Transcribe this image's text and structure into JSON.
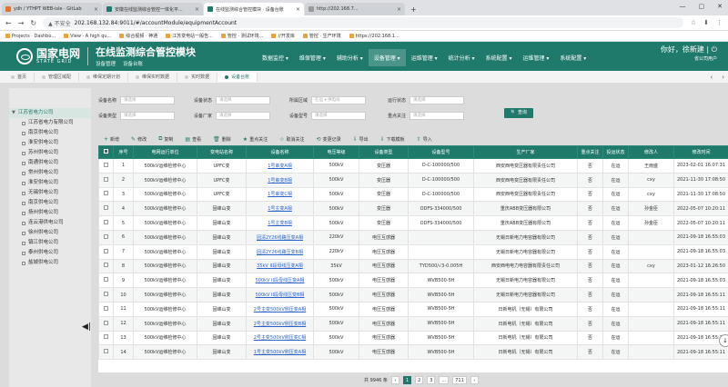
{
  "browser": {
    "tabs": [
      {
        "title": "ydh / YTHPT  WEB-isle · GitLab",
        "color": "#e2732b"
      },
      {
        "title": "安徽在线监测综合管控一体化平...",
        "color": "#1f7a6c"
      },
      {
        "title": "在线监测综合管控模块 · 设备台账",
        "color": "#1f7a6c"
      },
      {
        "title": "http://202.168.7...",
        "color": "#999999"
      }
    ],
    "new_tab": "+",
    "window_controls": [
      "—",
      "▢",
      "✕"
    ],
    "nav": [
      "←",
      "→",
      "↻"
    ],
    "url_warning": "▲ 不安全",
    "url": "202.168.132.84:9011/#/accountModule/equipmentAccount",
    "right_icons": [
      "☆",
      "⬇",
      "⋮"
    ],
    "bookmarks": [
      "Projects · Dashbo...",
      "View · A high qu...",
      "综合视频 · 神通",
      "江苏变电站一般告...",
      "管控 · 测试环境...",
      "//开发库",
      "管控 · 生产环境",
      "https://202.168.1..."
    ]
  },
  "header": {
    "logo_cn": "国家电网",
    "logo_en": "STATE GRID",
    "title": "在线监测综合管控模块",
    "sub": [
      "设备管理",
      "设备台账"
    ],
    "nav": [
      {
        "label": "数据监控 ▾",
        "active": false
      },
      {
        "label": "维保管理 ▾",
        "active": false
      },
      {
        "label": "辅助分析 ▾",
        "active": false
      },
      {
        "label": "设备管理 ▾",
        "active": true
      },
      {
        "label": "运维管理 ▾",
        "active": false
      },
      {
        "label": "统计分析 ▾",
        "active": false
      },
      {
        "label": "系统配置 ▾",
        "active": false
      },
      {
        "label": "运维管理 ▾",
        "active": false
      },
      {
        "label": "系统配置 ▾",
        "active": false
      }
    ],
    "greeting": "你好，徐新建 | ⏻",
    "role": "省公司用户"
  },
  "page_tabs": [
    {
      "label": "首页",
      "active": false
    },
    {
      "label": "管理区域配",
      "active": false
    },
    {
      "label": "维保定期计划",
      "active": false
    },
    {
      "label": "维保实时数据",
      "active": false
    },
    {
      "label": "实时数据",
      "active": false
    },
    {
      "label": "设备台账",
      "active": true
    }
  ],
  "page_tab_arrows": [
    "‹",
    "›"
  ],
  "sidebar": {
    "root": "江苏省电力公司",
    "items": [
      "江苏省电力有限公司",
      "南京供电公司",
      "淮安供电公司",
      "苏州供电公司",
      "南通供电公司",
      "常州供电公司",
      "淮安供电公司",
      "无锡供电公司",
      "南京供电公司",
      "扬州供电公司",
      "连云港供电公司",
      "徐州供电公司",
      "镇江供电公司",
      "泰州供电公司",
      "盐城供电公司"
    ],
    "collapse": "◀|"
  },
  "filters": [
    {
      "label": "设备名称",
      "placeholder": "请选择",
      "row": 0,
      "col": 0
    },
    {
      "label": "设备状态",
      "placeholder": "请选择",
      "row": 0,
      "col": 1
    },
    {
      "label": "所属区域",
      "placeholder": "在运 ▾  供电局",
      "row": 0,
      "col": 2
    },
    {
      "label": "运行状态",
      "placeholder": "请选择",
      "row": 0,
      "col": 3
    },
    {
      "label": "设备类型",
      "placeholder": "请选择",
      "row": 1,
      "col": 0
    },
    {
      "label": "设备厂家",
      "placeholder": "请选择",
      "row": 1,
      "col": 1
    },
    {
      "label": "设备型号",
      "placeholder": "请选择",
      "row": 1,
      "col": 2
    },
    {
      "label": "重点关注",
      "placeholder": "请选择",
      "row": 1,
      "col": 3
    }
  ],
  "query_button": "🔍 查询",
  "toolbar": [
    {
      "icon": "+",
      "label": "新增"
    },
    {
      "icon": "✎",
      "label": "修改"
    },
    {
      "icon": "⧉",
      "label": "复制"
    },
    {
      "icon": "▤",
      "label": "查看"
    },
    {
      "icon": "🗑",
      "label": "删除"
    },
    {
      "icon": "★",
      "label": "重点关注"
    },
    {
      "icon": "☆",
      "label": "取消关注"
    },
    {
      "icon": "⟲",
      "label": "变更记录"
    },
    {
      "icon": "⇩",
      "label": "导出"
    },
    {
      "icon": "⇩",
      "label": "下载模板"
    },
    {
      "icon": "⇧",
      "label": "导入"
    }
  ],
  "table": {
    "columns": [
      "",
      "序号",
      "电网运行单位",
      "变电站名称",
      "设备名称",
      "电压等级",
      "设备类型",
      "设备型号",
      "生产厂家",
      "重点关注",
      "投运状态",
      "修改人",
      "修改时间"
    ],
    "rows": [
      [
        "1",
        "500kV运维检修中心",
        "UPFC变",
        "1号串变A相",
        "500kV",
        "变压器",
        "D-C-100000/500",
        "西安西电变压器有限责任公司",
        "否",
        "在运",
        "王雨盛",
        "2023-02-01 16:07:31"
      ],
      [
        "2",
        "500kV运维检修中心",
        "UPFC变",
        "1号串变B相",
        "500kV",
        "变压器",
        "D-C-100000/500",
        "西安西电变压器有限责任公司",
        "否",
        "在运",
        "cxy",
        "2021-11-30 17:08:50"
      ],
      [
        "3",
        "500kV运维检修中心",
        "UPFC变",
        "1号串变C相",
        "500kV",
        "变压器",
        "D-C-100000/500",
        "西安西电变压器有限责任公司",
        "否",
        "在运",
        "cxy",
        "2021-11-30 17:08:50"
      ],
      [
        "4",
        "500kV运维检修中心",
        "固峰山变",
        "1号主变A相",
        "500kV",
        "变压器",
        "ODFS-334000/500",
        "重庆ABB变压器有限公司",
        "否",
        "在运",
        "孙金臣",
        "2022-05-07 10:20:11"
      ],
      [
        "5",
        "500kV运维检修中心",
        "固峰山变",
        "1号主变B相",
        "500kV",
        "变压器",
        "ODFS-334000/500",
        "重庆ABB变压器有限公司",
        "否",
        "在运",
        "孙金臣",
        "2022-05-07 10:20:11"
      ],
      [
        "6",
        "500kV运维检修中心",
        "固峰山变",
        "固清2Y26线路压变A相",
        "220kV",
        "电压互感器",
        "",
        "无锡日新电力电容器有限公司",
        "否",
        "在运",
        "",
        "2021-09-18 16:55:03"
      ],
      [
        "7",
        "500kV运维检修中心",
        "固峰山变",
        "固清2Y26线路压变B相",
        "220kV",
        "电压互感器",
        "",
        "无锡日新电力电容器有限公司",
        "否",
        "在运",
        "",
        "2021-09-18 16:55:03"
      ],
      [
        "8",
        "500kV运维检修中心",
        "固峰山变",
        "35kV II段母线压变A相",
        "35kV",
        "电压互感器",
        "TYD500/√3-0.005H",
        "西安西电电力电容器有限责任公司",
        "否",
        "在运",
        "cxy",
        "2023-01-12 16:26:50"
      ],
      [
        "9",
        "500kV运维检修中心",
        "固峰山变",
        "500kV II段母线压变A相",
        "500kV",
        "电压互感器",
        "WVB500-5H",
        "无锡日新电力电容器有限公司",
        "否",
        "在运",
        "",
        "2021-09-18 16:55:03"
      ],
      [
        "10",
        "500kV运维检修中心",
        "固峰山变",
        "500kV II段母线压变B相",
        "500kV",
        "电压互感器",
        "WVB500-5H",
        "无锡日新电力电容器有限公司",
        "否",
        "在运",
        "",
        "2021-09-18 16:55:11"
      ],
      [
        "11",
        "500kV运维检修中心",
        "固峰山变",
        "2号主变500kV侧压变A相",
        "500kV",
        "电压互感器",
        "WVB500-5H",
        "日新电机（无锡）有限公司",
        "否",
        "在运",
        "",
        "2021-09-18 16:55:11"
      ],
      [
        "12",
        "500kV运维检修中心",
        "固峰山变",
        "2号主变500kV侧压变B相",
        "500kV",
        "电压互感器",
        "WVB500-5H",
        "日新电机（无锡）有限公司",
        "否",
        "在运",
        "",
        "2021-09-18 16:55:11"
      ],
      [
        "13",
        "500kV运维检修中心",
        "固峰山变",
        "2号主变500kV侧压变C相",
        "500kV",
        "电压互感器",
        "WVB500-5H",
        "日新电机（无锡）有限公司",
        "否",
        "在运",
        "",
        "2021-09-18 16:55:11"
      ],
      [
        "14",
        "500kV运维检修中心",
        "固峰山变",
        "1号主变500kV侧压变A相",
        "500kV",
        "电压互感器",
        "WVB500-5H",
        "日新电机（无锡）有限公司",
        "否",
        "在运",
        "",
        "2021-09-18 16:55:11"
      ]
    ]
  },
  "pager": {
    "total": "共 9946 条",
    "prev": "‹",
    "pages": [
      "1",
      "2",
      "3",
      "...",
      "711"
    ],
    "current": "1",
    "next": "›"
  },
  "scroll_button": "↓",
  "colors": {
    "brand": "#1f7a6c",
    "link": "#2a62c9"
  }
}
